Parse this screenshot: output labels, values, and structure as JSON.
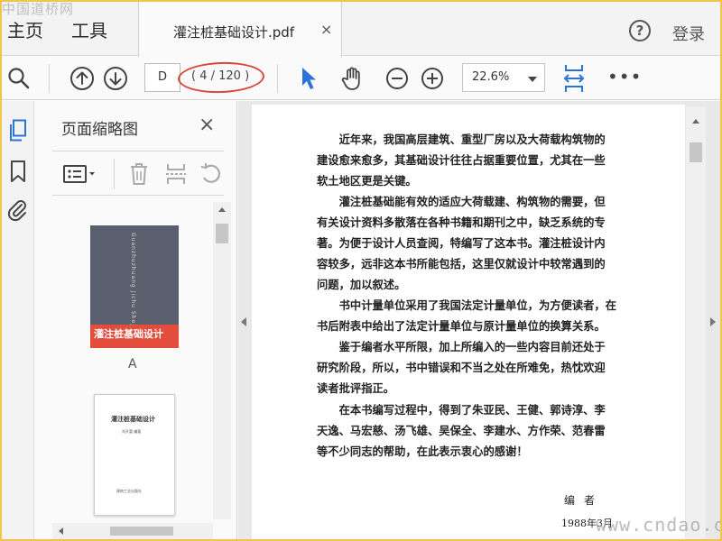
{
  "watermark_top": "中国道桥网",
  "watermark_bottom": "www.cndao.com",
  "menu": {
    "home": "主页",
    "tools": "工具"
  },
  "tab": {
    "title": "灌注桩基础设计.pdf",
    "close": "×"
  },
  "header_right": {
    "help": "?",
    "login": "登录"
  },
  "toolbar": {
    "page_input": "D",
    "page_count": "( 4 / 120 )",
    "zoom": "22.6%",
    "more": "•••",
    "highlight_color": "#d9473c",
    "active_tool_color": "#2a73d8"
  },
  "thumbnails": {
    "panel_title": "页面缩略图",
    "close": "×",
    "pages": [
      {
        "label": "A",
        "cover_title": "灌注桩基础设计",
        "cover_vertical": "Guanzhuzhuang Jichu Sheji"
      },
      {
        "label": "",
        "title": "灌注桩基础设计",
        "author": "刘开富  编著",
        "publisher": "建筑工业出版社"
      }
    ]
  },
  "document": {
    "paragraphs": [
      [
        "近年来，我国高层建筑、重型厂房以及大荷载构筑物的",
        "建设愈来愈多，其基础设计往往占据重要位置，尤其在一些",
        "软土地区更是关键。"
      ],
      [
        "灌注桩基础能有效的适应大荷载建、构筑物的需要，但",
        "有关设计资料多散落在各种书籍和期刊之中，缺乏系统的专",
        "著。为便于设计人员查阅，特编写了这本书。灌注桩设计内",
        "容较多，远非这本书所能包括，这里仅就设计中较常遇到的",
        "问题，加以叙述。"
      ],
      [
        "书中计量单位采用了我国法定计量单位，为方便读者，在",
        "书后附表中给出了法定计量单位与原计量单位的换算关系。"
      ],
      [
        "鉴于编者水平所限，加上所编入的一些内容目前还处于",
        "研究阶段，所以，书中错误和不当之处在所难免，热忱欢迎",
        "读者批评指正。"
      ],
      [
        "在本书编写过程中，得到了朱亚民、王健、郭诗淳、李",
        "天逸、马宏慈、汤飞雄、吴保全、李建水、方作荣、范春雷",
        "等不少同志的帮助，在此表示衷心的感谢！"
      ]
    ],
    "signature": "编者",
    "date": "1988年3月"
  }
}
